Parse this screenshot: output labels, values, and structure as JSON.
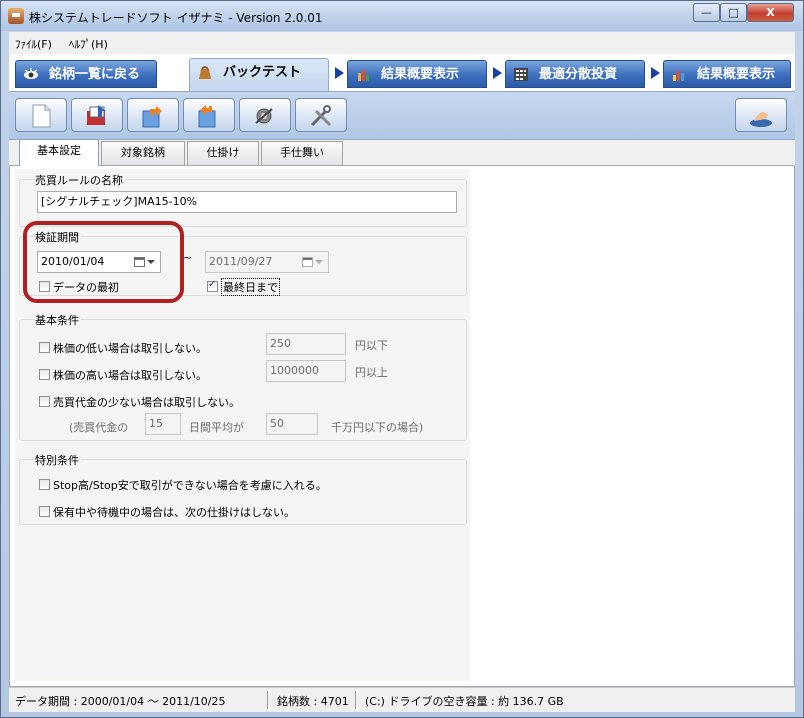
{
  "window": {
    "title": "株システムトレードソフト イザナミ - Version 2.0.01",
    "min_glyph": "—",
    "max_glyph": "□",
    "close_glyph": "X"
  },
  "menu": {
    "items": [
      "ﾌｧｲﾙ(F)",
      "ﾍﾙﾌﾟ(H)"
    ]
  },
  "bigtabs": [
    {
      "label": "銘柄一覧に戻る",
      "icon": "eye-icon"
    },
    {
      "label": "バックテスト",
      "icon": "bag-icon"
    },
    {
      "label": "結果概要表示",
      "icon": "hand-chart-icon"
    },
    {
      "label": "最適分散投資",
      "icon": "calculator-icon"
    },
    {
      "label": "結果概要表示",
      "icon": "bar-chart-icon"
    }
  ],
  "toolbar": {
    "buttons": [
      "new-document-icon",
      "open-folder-icon",
      "export-icon",
      "import-icon",
      "settings-icon",
      "tools-icon",
      "start-icon"
    ]
  },
  "subtabs": [
    "基本設定",
    "対象銘柄",
    "仕掛け",
    "手仕舞い"
  ],
  "rule_name": {
    "label": "売買ルールの名称",
    "value": "[シグナルチェック]MA15-10%"
  },
  "period": {
    "label": "検証期間",
    "start_date": "2010/01/04",
    "tilde": "~",
    "end_date": "2011/09/27",
    "from_data_start_label": "データの最初",
    "from_data_start_checked": false,
    "until_last_day_label": "最終日まで",
    "until_last_day_checked": true
  },
  "basic": {
    "label": "基本条件",
    "low_price_label": "株価の低い場合は取引しない。",
    "low_price_value": "250",
    "low_price_unit": "円以下",
    "high_price_label": "株価の高い場合は取引しない。",
    "high_price_value": "1000000",
    "high_price_unit": "円以上",
    "low_volume_label": "売買代金の少ない場合は取引しない。",
    "volume_prefix": "(売買代金の",
    "volume_days": "15",
    "volume_mid": "日間平均が",
    "volume_amount": "50",
    "volume_suffix": "千万円以下の場合)"
  },
  "special": {
    "label": "特別条件",
    "stop_limit_label": "Stop高/Stop安で取引ができない場合を考慮に入れる。",
    "holding_label": "保有中や待機中の場合は、次の仕掛けはしない。"
  },
  "status": {
    "data_period": "データ期間 : 2000/01/04 〜 2011/10/25",
    "stock_count": "銘柄数 : 4701",
    "free_space": "(C:) ドライブの空き容量 : 約 136.7 GB"
  },
  "colors": {
    "highlight": "#b02020",
    "tab_blue": "#3c6fbf",
    "arrow_blue": "#1a3fa0"
  }
}
